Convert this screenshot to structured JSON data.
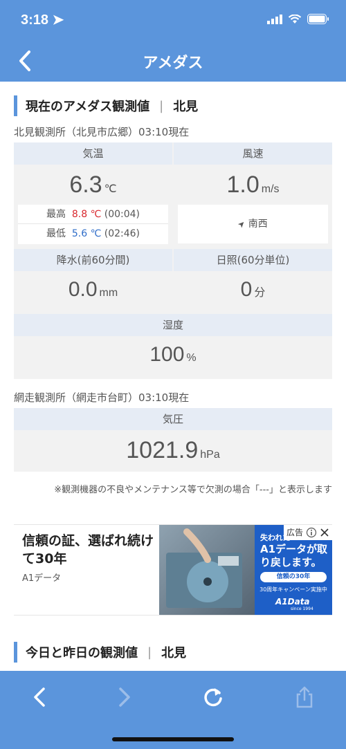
{
  "status": {
    "time": "3:18"
  },
  "nav": {
    "title": "アメダス"
  },
  "current": {
    "title": "現在のアメダス観測値",
    "sep": "|",
    "place": "北見",
    "station": "北見観測所（北見市広郷）03:10現在",
    "temp": {
      "label": "気温",
      "value": "6.3",
      "unit": "℃",
      "max_label": "最高",
      "max_value": "8.8 ℃",
      "max_time": "(00:04)",
      "min_label": "最低",
      "min_value": "5.6 ℃",
      "min_time": "(02:46)"
    },
    "wind": {
      "label": "風速",
      "value": "1.0",
      "unit": "m/s",
      "dir": "南西"
    },
    "rain": {
      "label": "降水(前60分間)",
      "value": "0.0",
      "unit": "mm"
    },
    "sun": {
      "label": "日照(60分単位)",
      "value": "0",
      "unit": "分"
    },
    "humid": {
      "label": "湿度",
      "value": "100",
      "unit": "%"
    },
    "station2": "網走観測所（網走市台町）03:10現在",
    "pressure": {
      "label": "気圧",
      "value": "1021.9",
      "unit": "hPa"
    },
    "note": "※観測機器の不良やメンテナンス等で欠測の場合「---」と表示します"
  },
  "ad": {
    "headline": "信頼の証、選ばれ続けて30年",
    "advertiser": "A1データ",
    "badge": "広告",
    "panel_top": "失われた",
    "panel_main": "A1データが取り戻します。",
    "panel_pill": "信頼の30年",
    "panel_sub": "30周年キャンペーン実施中",
    "panel_logo": "A1Data",
    "panel_since": "since 1994"
  },
  "compare": {
    "title": "今日と昨日の観測値",
    "sep": "|",
    "place": "北見"
  }
}
